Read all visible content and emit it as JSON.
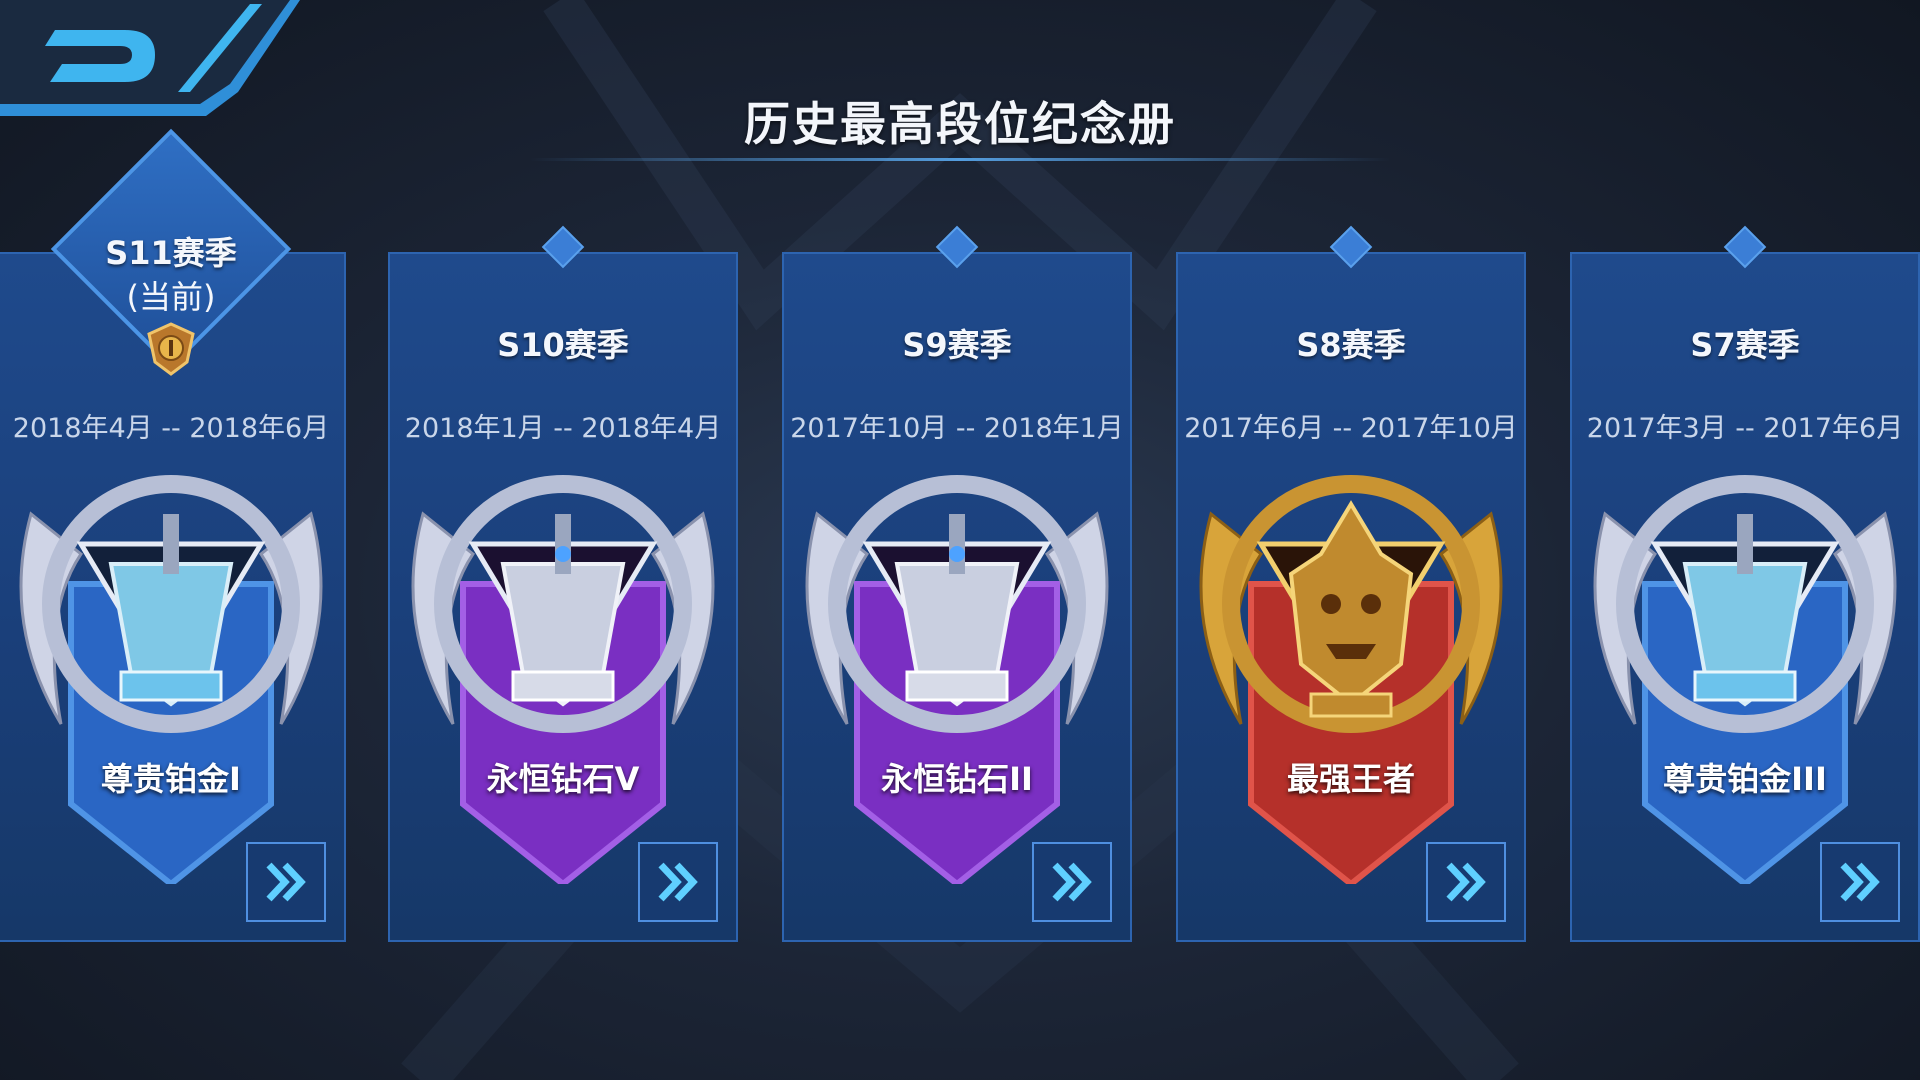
{
  "page": {
    "title": "历史最高段位纪念册"
  },
  "colors": {
    "card_blue": "#1f4a8c",
    "accent": "#4f8fe0",
    "platinum_blue": "#2f6fc8",
    "diamond_purple": "#7a2fc2",
    "king_red": "#b5302a",
    "king_gold": "#d8a43a"
  },
  "cards": [
    {
      "season": "S11赛季",
      "current_tag": "(当前)",
      "dates": "2018年4月 -- 2018年6月",
      "rank": "尊贵铂金I",
      "tier": "platinum",
      "detail_icon": "double-chevron-right-icon"
    },
    {
      "season": "S10赛季",
      "dates": "2018年1月 -- 2018年4月",
      "rank": "永恒钻石V",
      "tier": "diamond",
      "detail_icon": "double-chevron-right-icon"
    },
    {
      "season": "S9赛季",
      "dates": "2017年10月 -- 2018年1月",
      "rank": "永恒钻石II",
      "tier": "diamond",
      "detail_icon": "double-chevron-right-icon"
    },
    {
      "season": "S8赛季",
      "dates": "2017年6月 -- 2017年10月",
      "rank": "最强王者",
      "tier": "king",
      "detail_icon": "double-chevron-right-icon"
    },
    {
      "season": "S7赛季",
      "dates": "2017年3月 -- 2017年6月",
      "rank": "尊贵铂金III",
      "tier": "platinum",
      "detail_icon": "double-chevron-right-icon"
    }
  ]
}
